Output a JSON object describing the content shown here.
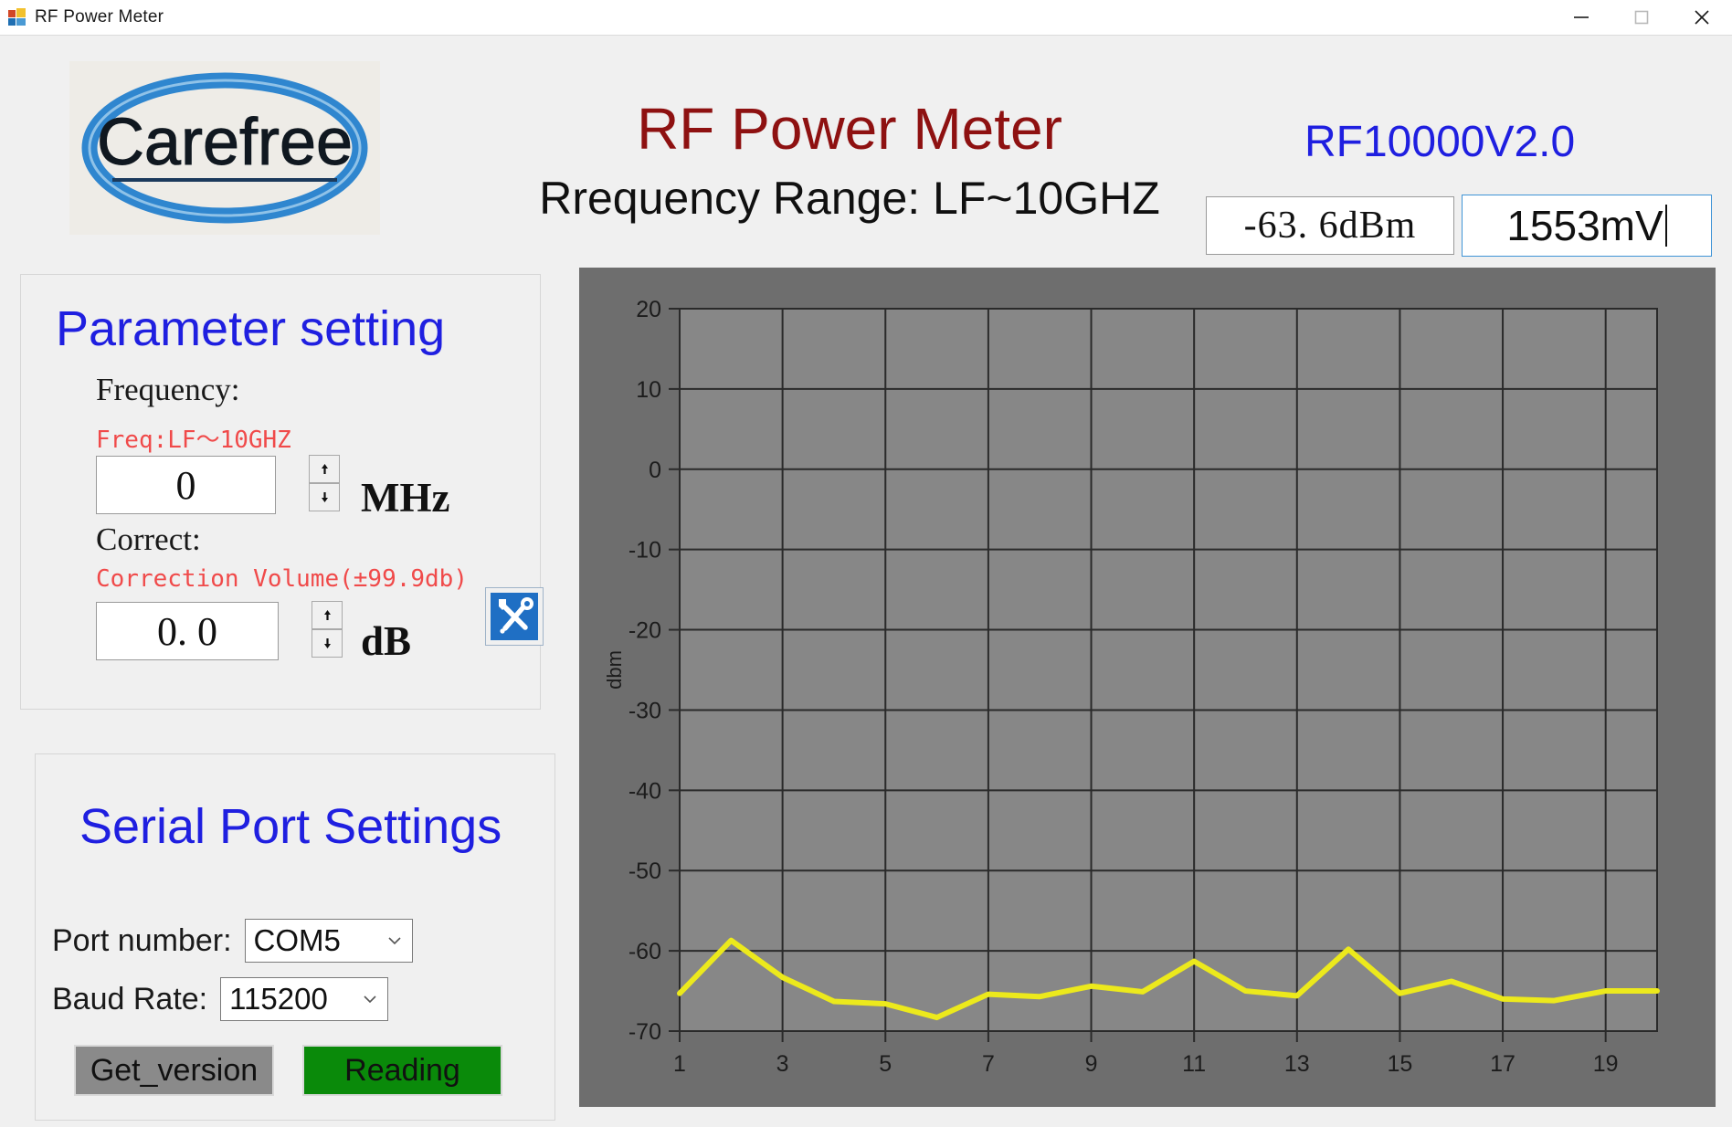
{
  "window": {
    "title": "RF Power Meter",
    "icon": "app-tiles-icon",
    "controls": [
      {
        "name": "minimize-button",
        "glyph": "minimize-icon"
      },
      {
        "name": "maximize-button",
        "glyph": "maximize-icon"
      },
      {
        "name": "close-button",
        "glyph": "close-icon"
      }
    ]
  },
  "header": {
    "logo_text": "Carefree",
    "logo_color": "#2f86cf",
    "title": "RF Power Meter",
    "title_color": "#8e1111",
    "subtitle": "Rrequency Range: LF~10GHZ",
    "version": "RF10000V2.0",
    "version_color": "#1f1fe0",
    "dbm_readout": "-63. 6dBm",
    "mv_readout": "1553mV"
  },
  "parameter_panel": {
    "title": "Parameter setting",
    "frequency_label": "Frequency:",
    "frequency_hint": "Freq:LF～10GHZ",
    "frequency_value": "0",
    "frequency_unit": "MHz",
    "correct_label": "Correct:",
    "correct_hint": "Correction Volume(±99.9db)",
    "correct_value": "0. 0",
    "correct_unit": "dB",
    "tools_icon": "wrench-screwdriver-icon"
  },
  "serial_panel": {
    "title": "Serial Port Settings",
    "port_label": "Port number:",
    "port_value": "COM5",
    "baud_label": "Baud Rate:",
    "baud_value": "115200",
    "get_version_label": "Get_version",
    "get_version_color": "#8a8a8a",
    "reading_label": "Reading",
    "reading_color": "#0a8a0a"
  },
  "chart_data": {
    "type": "line",
    "title": "",
    "xlabel": "",
    "ylabel": "dbm",
    "ylim": [
      -70,
      20
    ],
    "xlim": [
      1,
      20
    ],
    "grid": true,
    "legend": false,
    "line_color": "#ece91c",
    "plot_bg": "#878787",
    "surround_bg": "#6e6e6e",
    "ytick_labels": [
      "20",
      "10",
      "0",
      "-10",
      "-20",
      "-30",
      "-40",
      "-50",
      "-60",
      "-70"
    ],
    "yticks": [
      20,
      10,
      0,
      -10,
      -20,
      -30,
      -40,
      -50,
      -60,
      -70
    ],
    "xtick_labels": [
      "1",
      "3",
      "5",
      "7",
      "9",
      "11",
      "13",
      "15",
      "17",
      "19"
    ],
    "xticks": [
      1,
      3,
      5,
      7,
      9,
      11,
      13,
      15,
      17,
      19
    ],
    "x": [
      1,
      2,
      3,
      4,
      5,
      6,
      7,
      8,
      9,
      10,
      11,
      12,
      13,
      14,
      15,
      16,
      17,
      18,
      19,
      20
    ],
    "values": [
      -65.3,
      -58.7,
      -63.3,
      -66.3,
      -66.6,
      -68.3,
      -65.4,
      -65.7,
      -64.4,
      -65.1,
      -61.3,
      -65.0,
      -65.6,
      -59.8,
      -65.3,
      -63.8,
      -66.0,
      -66.2,
      -65.0,
      -65.0
    ]
  }
}
